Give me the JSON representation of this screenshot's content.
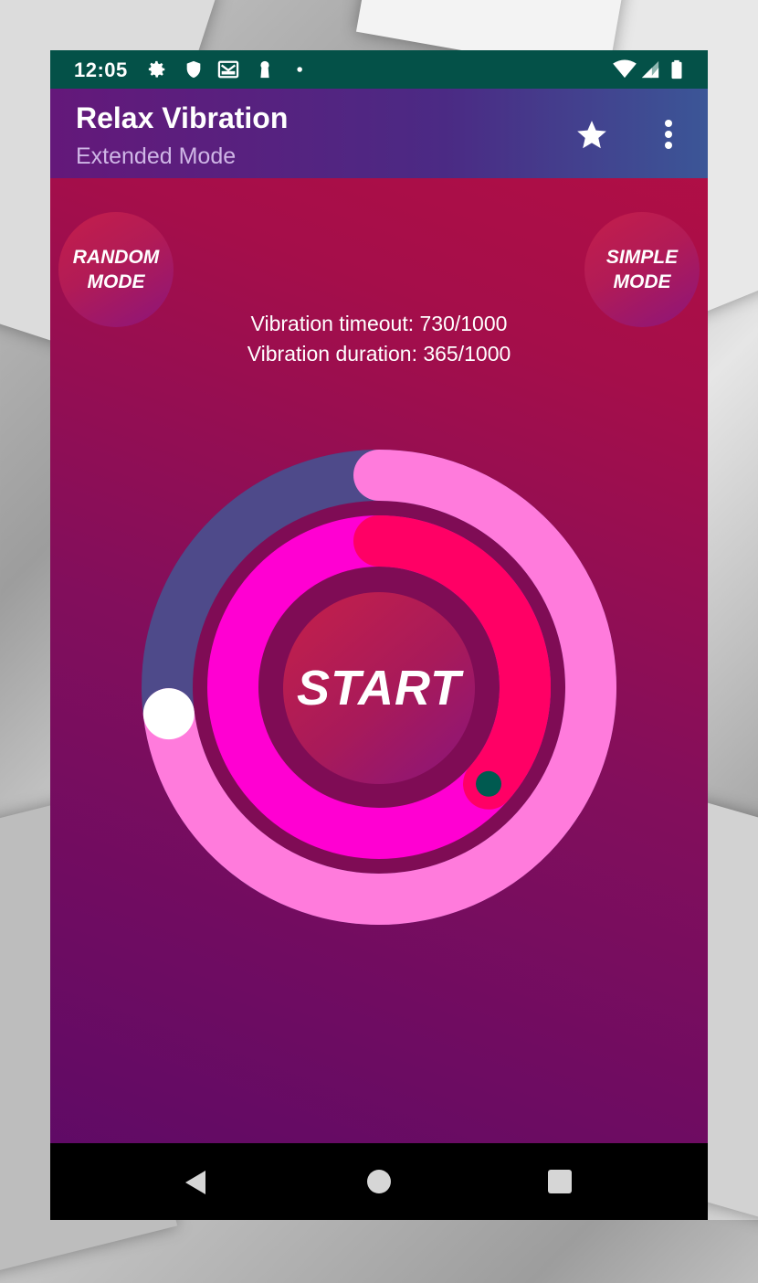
{
  "status_bar": {
    "time": "12:05",
    "icons": [
      "gear-icon",
      "shield-icon",
      "gmail-icon",
      "keyhole-icon",
      "dot-icon",
      "wifi-icon",
      "signal-icon",
      "battery-icon"
    ]
  },
  "app_bar": {
    "title": "Relax Vibration",
    "subtitle": "Extended Mode",
    "actions": [
      "star-icon",
      "more-vert-icon"
    ]
  },
  "modes": {
    "random_line1": "RANDOM",
    "random_line2": "MODE",
    "simple_line1": "SIMPLE",
    "simple_line2": "MODE"
  },
  "info": {
    "timeout_text": "Vibration timeout: 730/1000",
    "duration_text": "Vibration duration: 365/1000"
  },
  "dial": {
    "outer": {
      "value": 730,
      "max": 1000,
      "progress_color": "#ff7bdc",
      "remaining_color": "#4e4a8a",
      "thumb_color": "#ffffff"
    },
    "inner": {
      "value": 365,
      "max": 1000,
      "progress_color": "#ff0065",
      "remaining_color": "#ff00d2",
      "thumb_color": "#005a50",
      "thumb_ring_color": "#ff0065"
    },
    "track_gap_color": "#7f0c55"
  },
  "start_label": "START",
  "nav": [
    "back-icon",
    "home-icon",
    "recents-icon"
  ],
  "colors": {
    "status_bar": "#045148",
    "app_bar_start": "#64187a",
    "app_bar_end": "#3b5697"
  }
}
